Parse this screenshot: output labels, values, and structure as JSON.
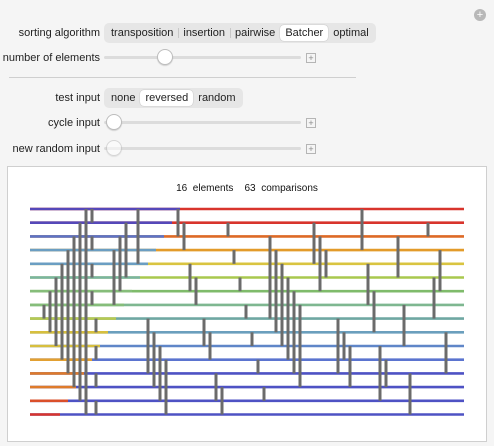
{
  "controls": {
    "algorithm": {
      "label": "sorting algorithm",
      "options": [
        "transposition",
        "insertion",
        "pairwise",
        "Batcher",
        "optimal"
      ],
      "selected": "Batcher"
    },
    "elements": {
      "label": "number of elements",
      "value": 16
    },
    "test_input": {
      "label": "test input",
      "options": [
        "none",
        "reversed",
        "random"
      ],
      "selected": "reversed"
    },
    "cycle_input": {
      "label": "cycle input"
    },
    "random_input": {
      "label": "new random input"
    }
  },
  "caption": {
    "elements_count": "16",
    "elements_label": "elements",
    "comparisons_count": "63",
    "comparisons_label": "comparisons"
  },
  "network": {
    "wire_colors": [
      "#d8342c",
      "#d8342c",
      "#dd6a26",
      "#e39b2a",
      "#d9c440",
      "#a9c84e",
      "#7fbb6b",
      "#7eb790",
      "#6fa7a2",
      "#6b9fbd",
      "#5f86c8",
      "#5b74cf",
      "#4e52c4",
      "#4e52c4"
    ],
    "segment_colors": [
      "#5548b9",
      "#5c74c6",
      "#6b9ec2",
      "#79b5a1",
      "#86bd7a",
      "#b7c952",
      "#d7bf3e",
      "#e2a032",
      "#de7b2b",
      "#da4f2a",
      "#d8342c"
    ]
  }
}
